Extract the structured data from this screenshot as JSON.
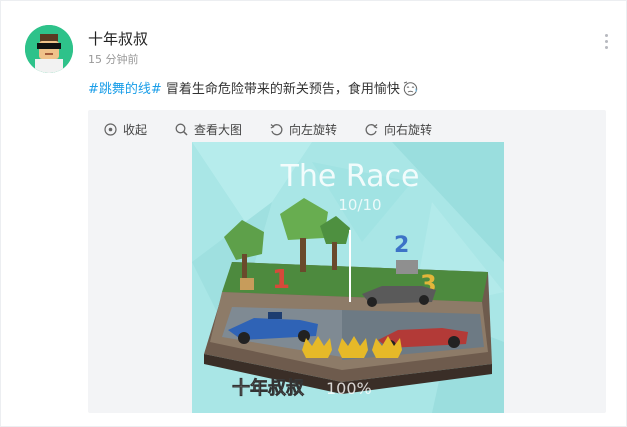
{
  "post": {
    "author": "十年叔叔",
    "time": "15 分钟前",
    "hashtag": "#跳舞的线#",
    "text": " 冒着生命危险带来的新关预告，食用愉快",
    "emoji_icon": "crying-face-icon"
  },
  "toolbar": {
    "collapse_label": "收起",
    "view_large_label": "查看大图",
    "rotate_left_label": "向左旋转",
    "rotate_right_label": "向右旋转"
  },
  "game": {
    "title": "The Race",
    "level": "10/10",
    "progress_label": "100%",
    "watermark": "十年叔叔",
    "markers": [
      "1",
      "2",
      "3"
    ]
  },
  "colors": {
    "link": "#1b9ee8",
    "avatar_bg": "#2ec28a",
    "game_bg": "#a9e6e6"
  }
}
